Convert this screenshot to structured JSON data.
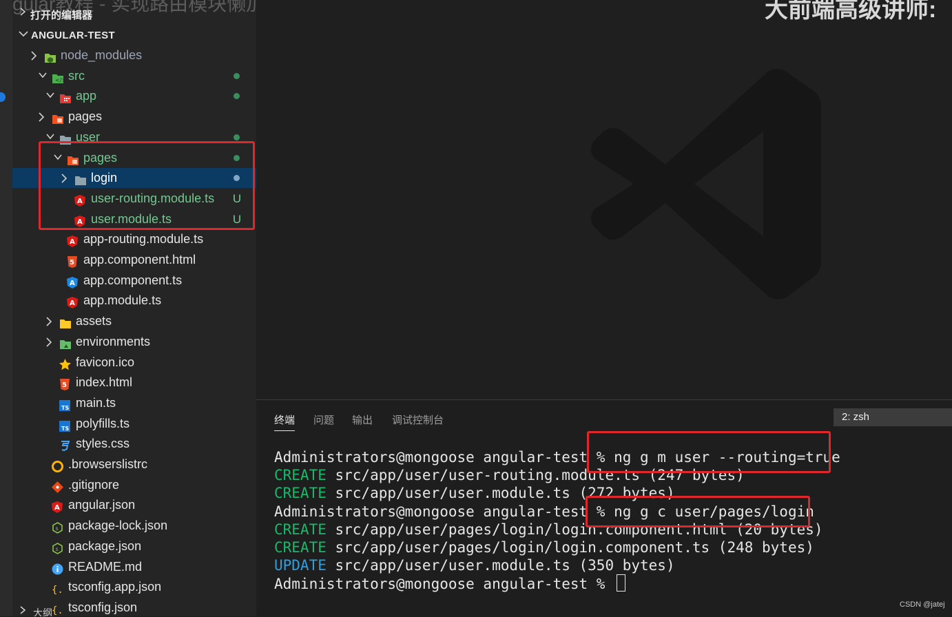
{
  "header": {
    "ghost_title": "gular教程 - 实现路由模块懒加载",
    "right_title": "大前端高级讲师:"
  },
  "explorer": {
    "open_editors": "打开的编辑器",
    "project": "ANGULAR-TEST",
    "items": [
      {
        "name": "node_modules",
        "color": "#9da5b4",
        "icon": "folder-node-icon",
        "chevron": "right"
      },
      {
        "name": "src",
        "color": "#73c991",
        "icon": "folder-src-icon",
        "chevron": "down",
        "badge": "dot"
      },
      {
        "name": "app",
        "color": "#73c991",
        "icon": "folder-app-icon",
        "chevron": "down",
        "badge": "dot"
      },
      {
        "name": "pages",
        "color": "#e6e6e6",
        "icon": "folder-pages-icon",
        "chevron": "right"
      },
      {
        "name": "user",
        "color": "#73c991",
        "icon": "folder-icon",
        "chevron": "down",
        "badge": "dot"
      },
      {
        "name": "pages",
        "color": "#73c991",
        "icon": "folder-pages-icon",
        "chevron": "down",
        "badge": "dot"
      },
      {
        "name": "login",
        "color": "#ffffff",
        "icon": "folder-icon",
        "chevron": "right",
        "badge": "dot",
        "selected": true
      },
      {
        "name": "user-routing.module.ts",
        "color": "#73c991",
        "icon": "angular-icon",
        "badge": "U"
      },
      {
        "name": "user.module.ts",
        "color": "#73c991",
        "icon": "angular-icon",
        "badge": "U"
      },
      {
        "name": "app-routing.module.ts",
        "color": "#e6e6e6",
        "icon": "angular-icon"
      },
      {
        "name": "app.component.html",
        "color": "#e6e6e6",
        "icon": "html-icon"
      },
      {
        "name": "app.component.ts",
        "color": "#e6e6e6",
        "icon": "angular-blue-icon"
      },
      {
        "name": "app.module.ts",
        "color": "#e6e6e6",
        "icon": "angular-icon"
      },
      {
        "name": "assets",
        "color": "#e6e6e6",
        "icon": "folder-assets-icon",
        "chevron": "right"
      },
      {
        "name": "environments",
        "color": "#e6e6e6",
        "icon": "folder-env-icon",
        "chevron": "right"
      },
      {
        "name": "favicon.ico",
        "color": "#e6e6e6",
        "icon": "star-icon"
      },
      {
        "name": "index.html",
        "color": "#e6e6e6",
        "icon": "html-icon"
      },
      {
        "name": "main.ts",
        "color": "#e6e6e6",
        "icon": "ts-icon"
      },
      {
        "name": "polyfills.ts",
        "color": "#e6e6e6",
        "icon": "ts-icon"
      },
      {
        "name": "styles.css",
        "color": "#e6e6e6",
        "icon": "css-icon"
      },
      {
        "name": ".browserslistrc",
        "color": "#e6e6e6",
        "icon": "browserslist-icon"
      },
      {
        "name": ".gitignore",
        "color": "#e6e6e6",
        "icon": "git-icon"
      },
      {
        "name": "angular.json",
        "color": "#e6e6e6",
        "icon": "angular-icon"
      },
      {
        "name": "package-lock.json",
        "color": "#e6e6e6",
        "icon": "nodejs-icon"
      },
      {
        "name": "package.json",
        "color": "#e6e6e6",
        "icon": "nodejs-icon"
      },
      {
        "name": "README.md",
        "color": "#e6e6e6",
        "icon": "info-icon"
      },
      {
        "name": "tsconfig.app.json",
        "color": "#e6e6e6",
        "icon": "json-icon"
      },
      {
        "name": "tsconfig.json",
        "color": "#e6e6e6",
        "icon": "json-icon"
      }
    ],
    "bottom_section": "大纲"
  },
  "panel": {
    "tabs": [
      "终端",
      "问题",
      "输出",
      "调试控制台"
    ],
    "active_tab": "终端",
    "terminal_select": "2: zsh",
    "lines": [
      {
        "type": "prompt",
        "prompt": "Administrators@mongoose angular-test % ",
        "cmd": "ng g m user --routing=true"
      },
      {
        "type": "create",
        "tag": "CREATE",
        "text": " src/app/user/user-routing.module.ts (247 bytes)"
      },
      {
        "type": "create",
        "tag": "CREATE",
        "text": " src/app/user/user.module.ts (272 bytes)"
      },
      {
        "type": "prompt",
        "prompt": "Administrators@mongoose angular-test % ",
        "cmd": "ng g c user/pages/login"
      },
      {
        "type": "create",
        "tag": "CREATE",
        "text": " src/app/user/pages/login/login.component.html (20 bytes)"
      },
      {
        "type": "create",
        "tag": "CREATE",
        "text": " src/app/user/pages/login/login.component.ts (248 bytes)"
      },
      {
        "type": "update",
        "tag": "UPDATE",
        "text": " src/app/user/user.module.ts (350 bytes)"
      },
      {
        "type": "prompt",
        "prompt": "Administrators@mongoose angular-test % ",
        "cmd": ""
      }
    ]
  },
  "watermark": "CSDN @jatej",
  "colors": {
    "highlight_box": "#e0272c",
    "git_untracked": "#73c991",
    "selection": "#0b3b63"
  }
}
